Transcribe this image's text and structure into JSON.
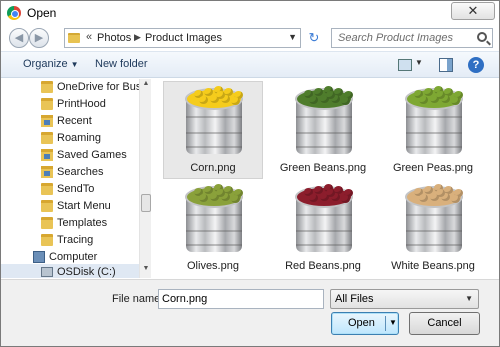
{
  "window": {
    "title": "Open",
    "close_glyph": "✕"
  },
  "navigation": {
    "back_glyph": "◀",
    "forward_glyph": "▶",
    "breadcrumb": {
      "overflow": "«",
      "segments": [
        "Photos",
        "Product Images"
      ],
      "separator": "▶",
      "dropdown_glyph": "▼"
    },
    "refresh_glyph": "↻",
    "search_placeholder": "Search Product Images"
  },
  "toolbar": {
    "organize_label": "Organize",
    "caret": "▼",
    "new_folder_label": "New folder",
    "help_label": "?"
  },
  "nav_pane": {
    "items": [
      {
        "label": "OneDrive for Busin",
        "icon": "folder-icon"
      },
      {
        "label": "PrintHood",
        "icon": "folder-icon"
      },
      {
        "label": "Recent",
        "icon": "recent-folder-icon"
      },
      {
        "label": "Roaming",
        "icon": "folder-icon"
      },
      {
        "label": "Saved Games",
        "icon": "saved-games-folder-icon"
      },
      {
        "label": "Searches",
        "icon": "searches-folder-icon"
      },
      {
        "label": "SendTo",
        "icon": "folder-icon"
      },
      {
        "label": "Start Menu",
        "icon": "folder-icon"
      },
      {
        "label": "Templates",
        "icon": "folder-icon"
      },
      {
        "label": "Tracing",
        "icon": "folder-icon"
      },
      {
        "label": "Computer",
        "icon": "computer-icon"
      },
      {
        "label": "OSDisk (C:)",
        "icon": "drive-icon"
      }
    ],
    "scroll_up": "▲",
    "scroll_down": "▼"
  },
  "files": [
    {
      "name": "Corn.png",
      "selected": true,
      "contents": "corn"
    },
    {
      "name": "Green Beans.png",
      "selected": false,
      "contents": "green-beans"
    },
    {
      "name": "Green Peas.png",
      "selected": false,
      "contents": "green-peas"
    },
    {
      "name": "Olives.png",
      "selected": false,
      "contents": "olives"
    },
    {
      "name": "Red Beans.png",
      "selected": false,
      "contents": "red-beans"
    },
    {
      "name": "White Beans.png",
      "selected": false,
      "contents": "white-beans"
    }
  ],
  "footer": {
    "file_name_label": "File name:",
    "file_name_value": "Corn.png",
    "file_type_value": "All Files",
    "open_label": "Open",
    "cancel_label": "Cancel"
  },
  "colors": {
    "corn": "#f5cc1c",
    "green-beans": "#4f7d2c",
    "green-peas": "#7ea833",
    "olives": "#8aa13a",
    "red-beans": "#8c1d2c",
    "white-beans": "#d9b07c"
  }
}
